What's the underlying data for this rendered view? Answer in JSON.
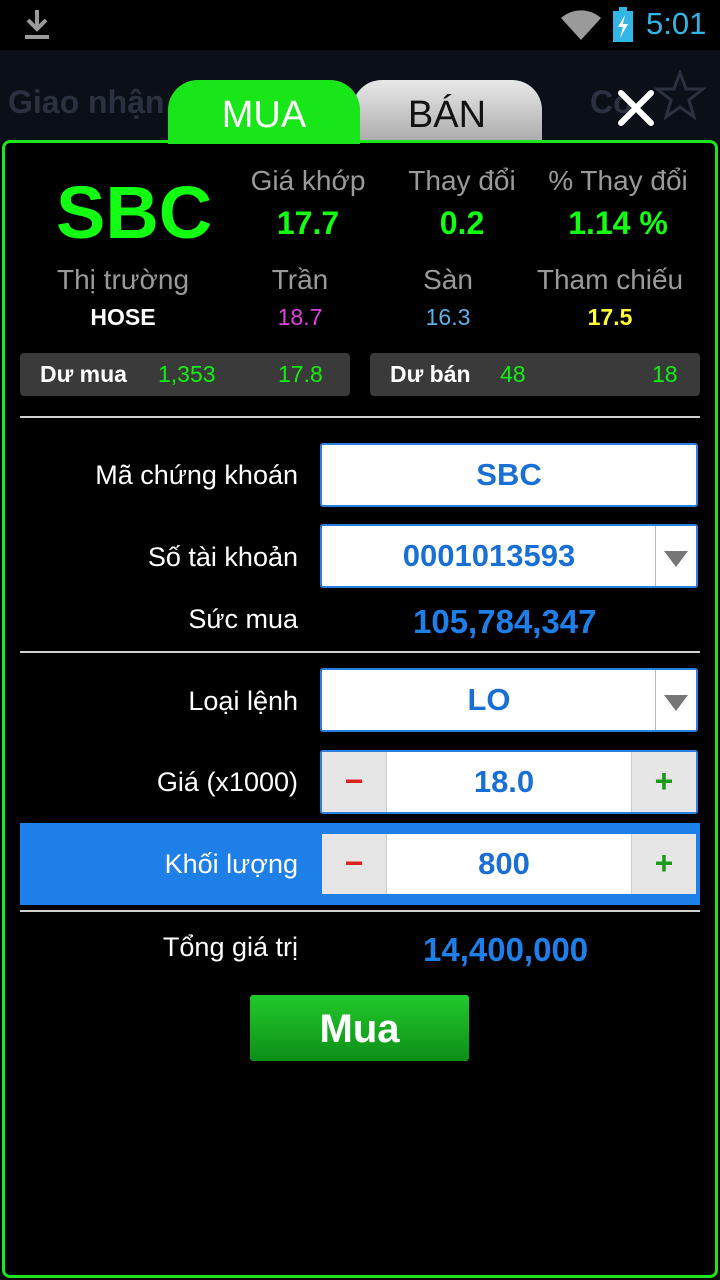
{
  "status_bar": {
    "time": "5:01",
    "time_color": "#33b5e5"
  },
  "background": {
    "left_text": "Giao nhận",
    "right_text": "Co"
  },
  "tabs": {
    "buy": "MUA",
    "sell": "BÁN"
  },
  "quote": {
    "symbol": "SBC",
    "match_price_label": "Giá khớp",
    "match_price": "17.7",
    "change_label": "Thay đổi",
    "change": "0.2",
    "pct_change_label": "% Thay đổi",
    "pct_change": "1.14 %",
    "market_label": "Thị trường",
    "market": "HOSE",
    "ceiling_label": "Trần",
    "ceiling": "18.7",
    "floor_label": "Sàn",
    "floor": "16.3",
    "ref_label": "Tham chiếu",
    "ref": "17.5",
    "colors": {
      "up": "#11ff11",
      "ceiling": "#e040e0",
      "floor": "#5ab0e8",
      "ref": "#ffff33"
    }
  },
  "depth": {
    "bid_label": "Dư mua",
    "bid_volume": "1,353",
    "bid_price": "17.8",
    "ask_label": "Dư bán",
    "ask_volume": "48",
    "ask_price": "18"
  },
  "form": {
    "symbol_label": "Mã chứng khoán",
    "symbol_value": "SBC",
    "account_label": "Số tài khoản",
    "account_value": "0001013593",
    "power_label": "Sức mua",
    "power_value": "105,784,347",
    "order_type_label": "Loại lệnh",
    "order_type_value": "LO",
    "price_label": "Giá (x1000)",
    "price_value": "18.0",
    "qty_label": "Khối lượng",
    "qty_value": "800",
    "total_label": "Tổng giá trị",
    "total_value": "14,400,000",
    "minus": "−",
    "plus": "+"
  },
  "actions": {
    "buy_label": "Mua"
  },
  "theme": {
    "accent_green": "#1ee41e",
    "accent_blue": "#1f7fe8"
  }
}
